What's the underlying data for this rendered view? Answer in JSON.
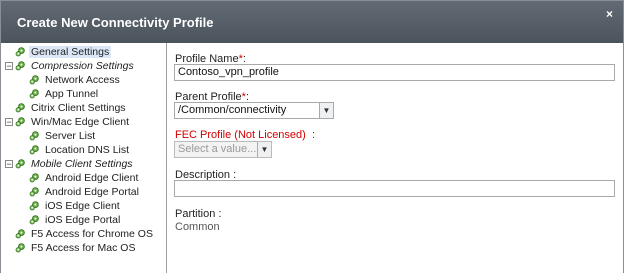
{
  "dialog": {
    "title": "Create New Connectivity Profile",
    "close_glyph": "×"
  },
  "tree": {
    "items": [
      {
        "label": "General Settings",
        "icon": "gear-icon",
        "selected": true
      },
      {
        "label": "Compression Settings",
        "icon": "gear-icon",
        "toggle": "−",
        "italic": true
      },
      {
        "label": "Network Access",
        "icon": "gear-icon"
      },
      {
        "label": "App Tunnel",
        "icon": "gear-icon"
      },
      {
        "label": "Citrix Client Settings",
        "icon": "gear-icon"
      },
      {
        "label": "Win/Mac Edge Client",
        "icon": "gear-icon",
        "toggle": "−"
      },
      {
        "label": "Server List",
        "icon": "gear-icon"
      },
      {
        "label": "Location DNS List",
        "icon": "gear-icon"
      },
      {
        "label": "Mobile Client Settings",
        "icon": "gear-icon",
        "toggle": "−",
        "italic": true
      },
      {
        "label": "Android Edge Client",
        "icon": "gear-icon"
      },
      {
        "label": "Android Edge Portal",
        "icon": "gear-icon"
      },
      {
        "label": "iOS Edge Client",
        "icon": "gear-icon"
      },
      {
        "label": "iOS Edge Portal",
        "icon": "gear-icon"
      },
      {
        "label": "F5 Access for Chrome OS",
        "icon": "gear-icon"
      },
      {
        "label": "F5 Access for Mac OS",
        "icon": "gear-icon"
      }
    ]
  },
  "form": {
    "profile_name_label": "Profile Name",
    "required_mark": "*",
    "colon": ":",
    "profile_name_value": "Contoso_vpn_profile",
    "parent_profile_label": "Parent Profile",
    "parent_profile_value": "/Common/connectivity",
    "fec_profile_label": "FEC Profile (Not Licensed)",
    "fec_profile_colon": ":",
    "fec_profile_placeholder": "Select a value...",
    "description_label": "Description :",
    "description_value": "",
    "partition_label": "Partition :",
    "partition_value": "Common"
  },
  "colors": {
    "titlebar": "#565e66",
    "required": "#cc0000",
    "selection": "#dbe7f7"
  }
}
